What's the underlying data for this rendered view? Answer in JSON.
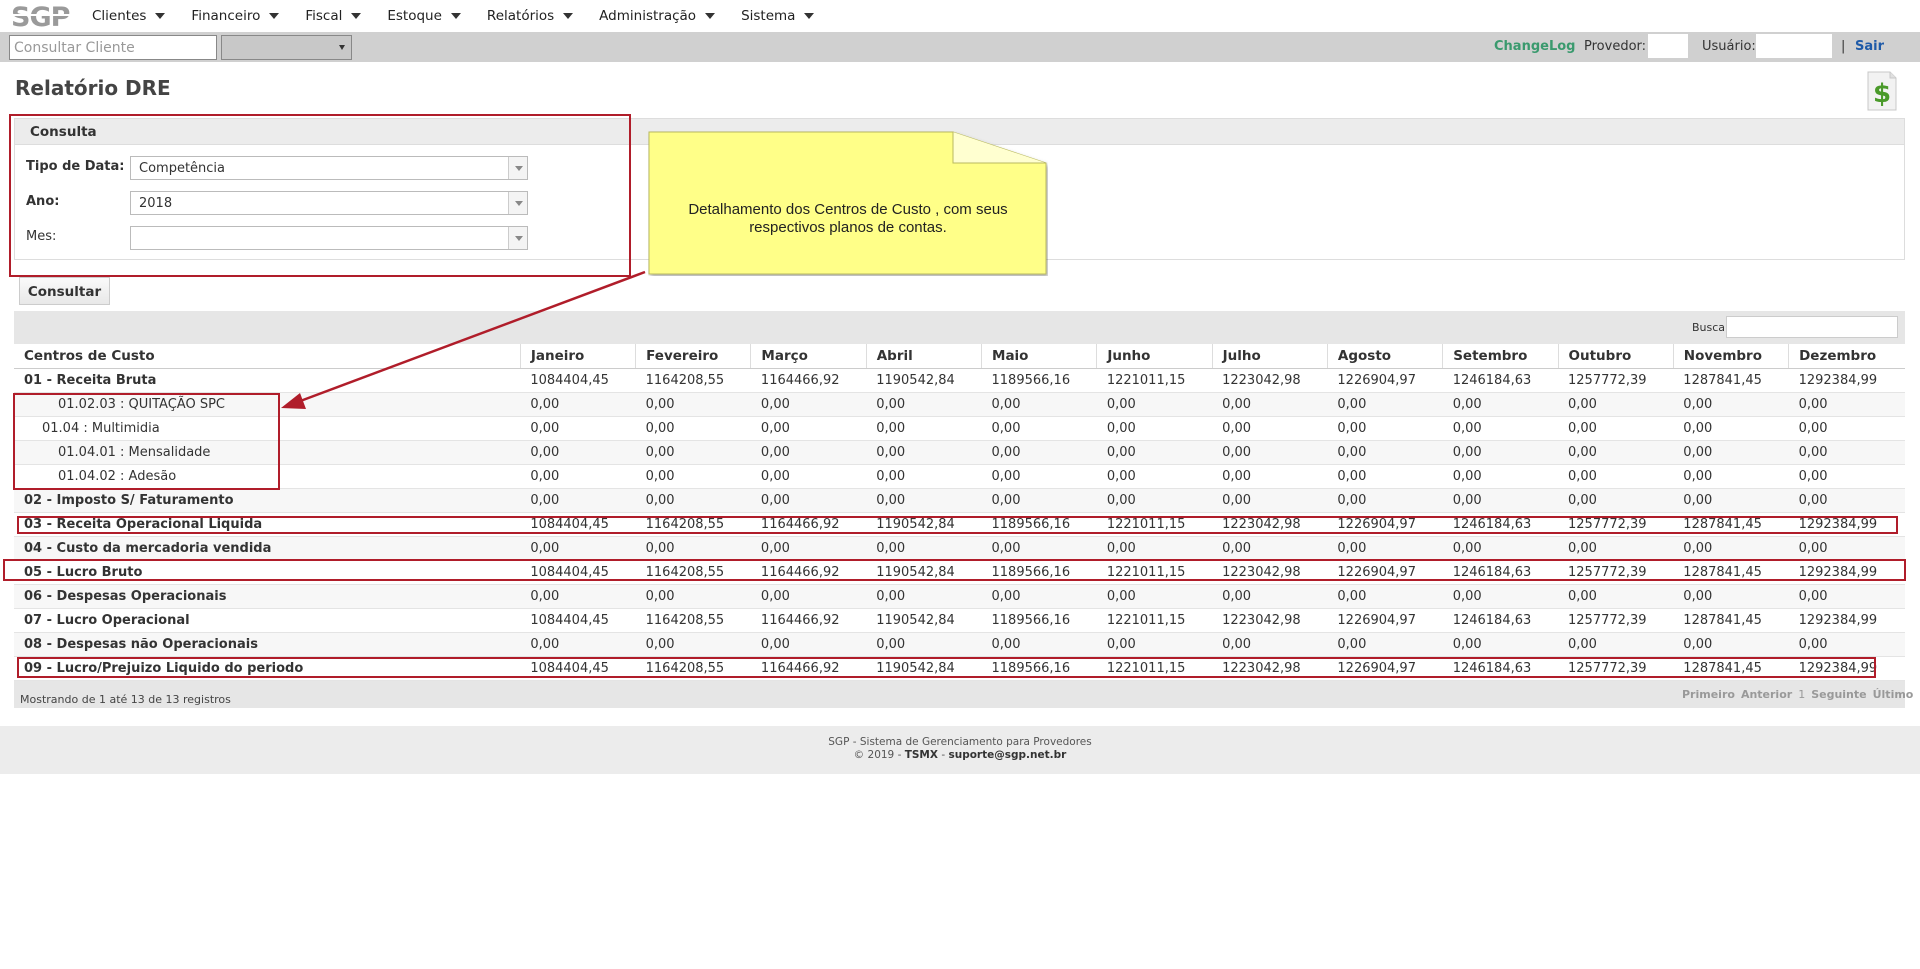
{
  "app": {
    "logo_text": "SGP"
  },
  "menu": [
    {
      "label": "Clientes"
    },
    {
      "label": "Financeiro"
    },
    {
      "label": "Fiscal"
    },
    {
      "label": "Estoque"
    },
    {
      "label": "Relatórios"
    },
    {
      "label": "Administração"
    },
    {
      "label": "Sistema"
    }
  ],
  "subbar": {
    "search_placeholder": "Consultar Cliente",
    "changelog": "ChangeLog",
    "provedor_label": "Provedor:",
    "usuario_label": "Usuário:",
    "separator": "|",
    "sair": "Sair"
  },
  "page": {
    "title": "Relatório DRE"
  },
  "consulta": {
    "title": "Consulta",
    "tipo_data_label": "Tipo de Data:",
    "tipo_data_value": "Competência",
    "ano_label": "Ano:",
    "ano_value": "2018",
    "mes_label": "Mes:",
    "mes_value": "",
    "button": "Consultar"
  },
  "annotation": {
    "note_text": "Detalhamento dos Centros de Custo , com seus respectivos planos de contas."
  },
  "table": {
    "search_label": "Buscar:",
    "headers": [
      "Centros de Custo",
      "Janeiro",
      "Fevereiro",
      "Março",
      "Abril",
      "Maio",
      "Junho",
      "Julho",
      "Agosto",
      "Setembro",
      "Outubro",
      "Novembro",
      "Dezembro"
    ],
    "rows": [
      {
        "name": "01 - Receita Bruta",
        "level": 0,
        "values": [
          "1084404,45",
          "1164208,55",
          "1164466,92",
          "1190542,84",
          "1189566,16",
          "1221011,15",
          "1223042,98",
          "1226904,97",
          "1246184,63",
          "1257772,39",
          "1287841,45",
          "1292384,99"
        ]
      },
      {
        "name": "01.02.03 : QUITAÇÃO SPC",
        "level": 2,
        "values": [
          "0,00",
          "0,00",
          "0,00",
          "0,00",
          "0,00",
          "0,00",
          "0,00",
          "0,00",
          "0,00",
          "0,00",
          "0,00",
          "0,00"
        ]
      },
      {
        "name": "01.04 : Multimidia",
        "level": 1,
        "values": [
          "0,00",
          "0,00",
          "0,00",
          "0,00",
          "0,00",
          "0,00",
          "0,00",
          "0,00",
          "0,00",
          "0,00",
          "0,00",
          "0,00"
        ]
      },
      {
        "name": "01.04.01 : Mensalidade",
        "level": 2,
        "values": [
          "0,00",
          "0,00",
          "0,00",
          "0,00",
          "0,00",
          "0,00",
          "0,00",
          "0,00",
          "0,00",
          "0,00",
          "0,00",
          "0,00"
        ]
      },
      {
        "name": "01.04.02 : Adesão",
        "level": 2,
        "values": [
          "0,00",
          "0,00",
          "0,00",
          "0,00",
          "0,00",
          "0,00",
          "0,00",
          "0,00",
          "0,00",
          "0,00",
          "0,00",
          "0,00"
        ]
      },
      {
        "name": "02 - Imposto S/ Faturamento",
        "level": 0,
        "values": [
          "0,00",
          "0,00",
          "0,00",
          "0,00",
          "0,00",
          "0,00",
          "0,00",
          "0,00",
          "0,00",
          "0,00",
          "0,00",
          "0,00"
        ]
      },
      {
        "name": "03 - Receita Operacional Liquida",
        "level": 0,
        "values": [
          "1084404,45",
          "1164208,55",
          "1164466,92",
          "1190542,84",
          "1189566,16",
          "1221011,15",
          "1223042,98",
          "1226904,97",
          "1246184,63",
          "1257772,39",
          "1287841,45",
          "1292384,99"
        ]
      },
      {
        "name": "04 - Custo da mercadoria vendida",
        "level": 0,
        "values": [
          "0,00",
          "0,00",
          "0,00",
          "0,00",
          "0,00",
          "0,00",
          "0,00",
          "0,00",
          "0,00",
          "0,00",
          "0,00",
          "0,00"
        ]
      },
      {
        "name": "05 - Lucro Bruto",
        "level": 0,
        "values": [
          "1084404,45",
          "1164208,55",
          "1164466,92",
          "1190542,84",
          "1189566,16",
          "1221011,15",
          "1223042,98",
          "1226904,97",
          "1246184,63",
          "1257772,39",
          "1287841,45",
          "1292384,99"
        ]
      },
      {
        "name": "06 - Despesas Operacionais",
        "level": 0,
        "values": [
          "0,00",
          "0,00",
          "0,00",
          "0,00",
          "0,00",
          "0,00",
          "0,00",
          "0,00",
          "0,00",
          "0,00",
          "0,00",
          "0,00"
        ]
      },
      {
        "name": "07 - Lucro Operacional",
        "level": 0,
        "values": [
          "1084404,45",
          "1164208,55",
          "1164466,92",
          "1190542,84",
          "1189566,16",
          "1221011,15",
          "1223042,98",
          "1226904,97",
          "1246184,63",
          "1257772,39",
          "1287841,45",
          "1292384,99"
        ]
      },
      {
        "name": "08 - Despesas não Operacionais",
        "level": 0,
        "values": [
          "0,00",
          "0,00",
          "0,00",
          "0,00",
          "0,00",
          "0,00",
          "0,00",
          "0,00",
          "0,00",
          "0,00",
          "0,00",
          "0,00"
        ]
      },
      {
        "name": "09 - Lucro/Prejuizo Liquido do periodo",
        "level": 0,
        "values": [
          "1084404,45",
          "1164208,55",
          "1164466,92",
          "1190542,84",
          "1189566,16",
          "1221011,15",
          "1223042,98",
          "1226904,97",
          "1246184,63",
          "1257772,39",
          "1287841,45",
          "1292384,99"
        ]
      }
    ],
    "info": "Mostrando de 1 até 13 de 13 registros",
    "pagination": {
      "first": "Primeiro",
      "prev": "Anterior",
      "page": "1",
      "next": "Seguinte",
      "last": "Último"
    }
  },
  "footer": {
    "line1": "SGP - Sistema de Gerenciamento para Provedores",
    "line2_prefix": "© 2019 -",
    "line2_company": "TSMX",
    "line2_sep": "-",
    "line2_email": "suporte@sgp.net.br"
  },
  "colors": {
    "annotation_red": "#b01d2a",
    "note_yellow": "#ffff88",
    "changelog_green": "#3a9a6e",
    "sair_blue": "#1e5aa8",
    "dollar_green": "#4a9a2a"
  }
}
